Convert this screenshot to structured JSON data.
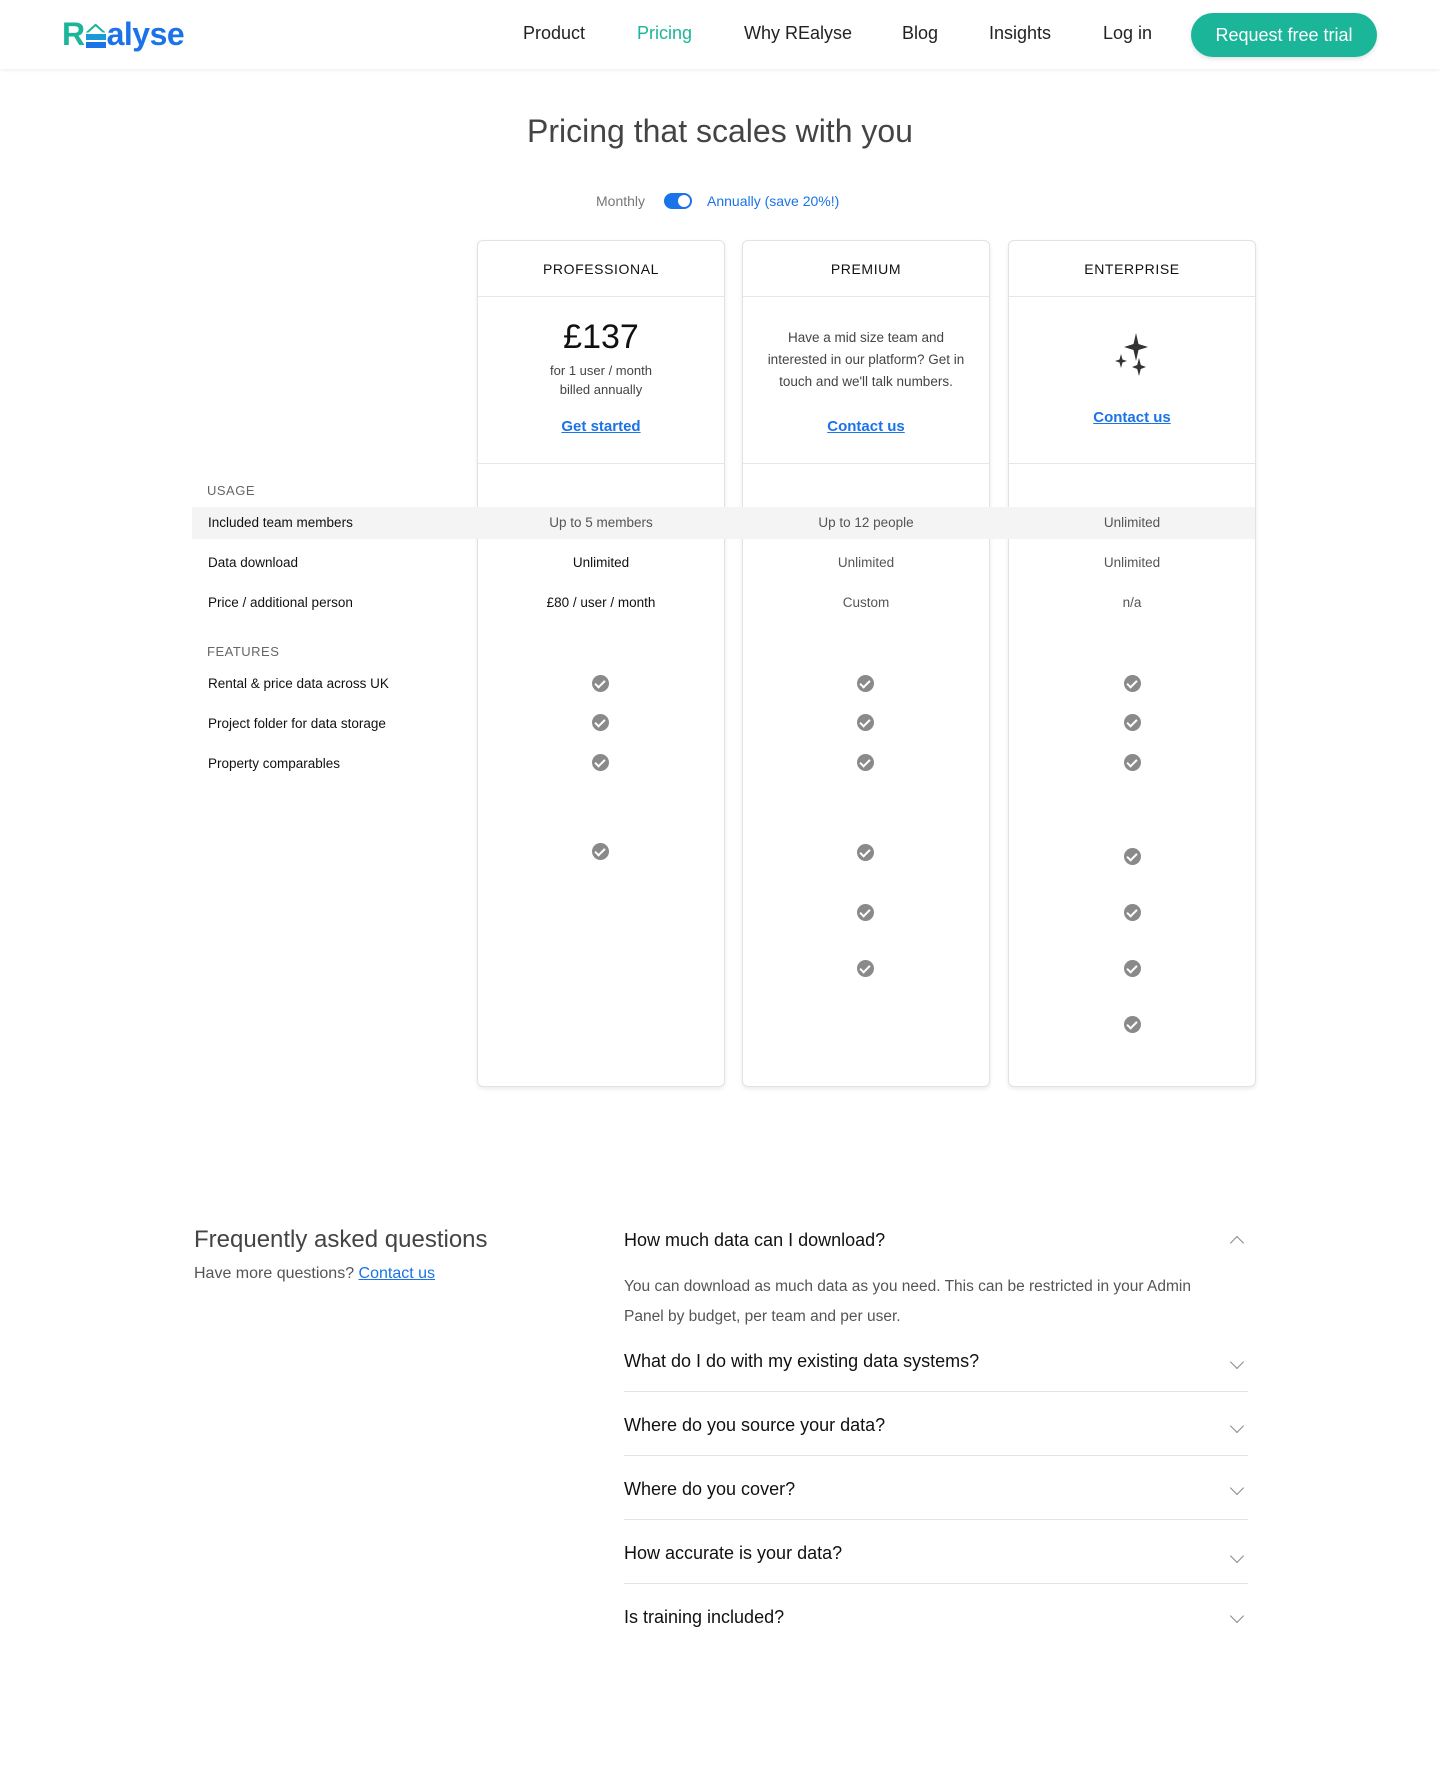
{
  "header": {
    "logo": {
      "r": "R",
      "rest": "alyse"
    },
    "nav": [
      "Product",
      "Pricing",
      "Why REalyse",
      "Blog",
      "Insights",
      "Log in"
    ],
    "active_nav": "Pricing",
    "cta": "Request free trial"
  },
  "title": "Pricing that scales with you",
  "billing_toggle": {
    "monthly": "Monthly",
    "annually": "Annually (save 20%!)",
    "selected": "annually"
  },
  "plans": [
    {
      "name": "PROFESSIONAL",
      "price": "£137",
      "price_note_1": "for 1 user / month",
      "price_note_2": "billed annually",
      "link": "Get started"
    },
    {
      "name": "PREMIUM",
      "description": "Have a mid size team and interested in our platform? Get in touch and we'll talk numbers.",
      "link": "Contact us"
    },
    {
      "name": "ENTERPRISE",
      "icon": "sparkle-icon",
      "link": "Contact us"
    }
  ],
  "usage": {
    "label": "USAGE",
    "rows": [
      {
        "label": "Included team members",
        "values": [
          "Up to 5 members",
          "Up to 12 people",
          "Unlimited"
        ]
      },
      {
        "label": "Data download",
        "values": [
          "Unlimited",
          "Unlimited",
          "Unlimited"
        ]
      },
      {
        "label": "Price / additional person",
        "values": [
          "£80 / user / month",
          "Custom",
          "n/a"
        ]
      }
    ]
  },
  "features": {
    "label": "FEATURES",
    "rows": [
      {
        "label": "Rental & price data across UK"
      },
      {
        "label": "Project folder for data storage"
      },
      {
        "label": "Property comparables"
      }
    ]
  },
  "faq": {
    "title": "Frequently asked questions",
    "subtitle": "Have more questions?",
    "contact_link": "Contact us",
    "items": [
      {
        "q": "How much data can I download?",
        "a": "You can download as much data as you need. This can be restricted in your Admin Panel by budget, per team and per user.",
        "open": true
      },
      {
        "q": "What do I do with my existing data systems?",
        "open": false
      },
      {
        "q": "Where do you source your data?",
        "open": false
      },
      {
        "q": "Where do you cover?",
        "open": false
      },
      {
        "q": "How accurate is your data?",
        "open": false
      },
      {
        "q": "Is training included?",
        "open": false
      }
    ]
  },
  "colors": {
    "accent": "#1bb59a",
    "link": "#1a73e8",
    "check": "#8a8a8a"
  }
}
